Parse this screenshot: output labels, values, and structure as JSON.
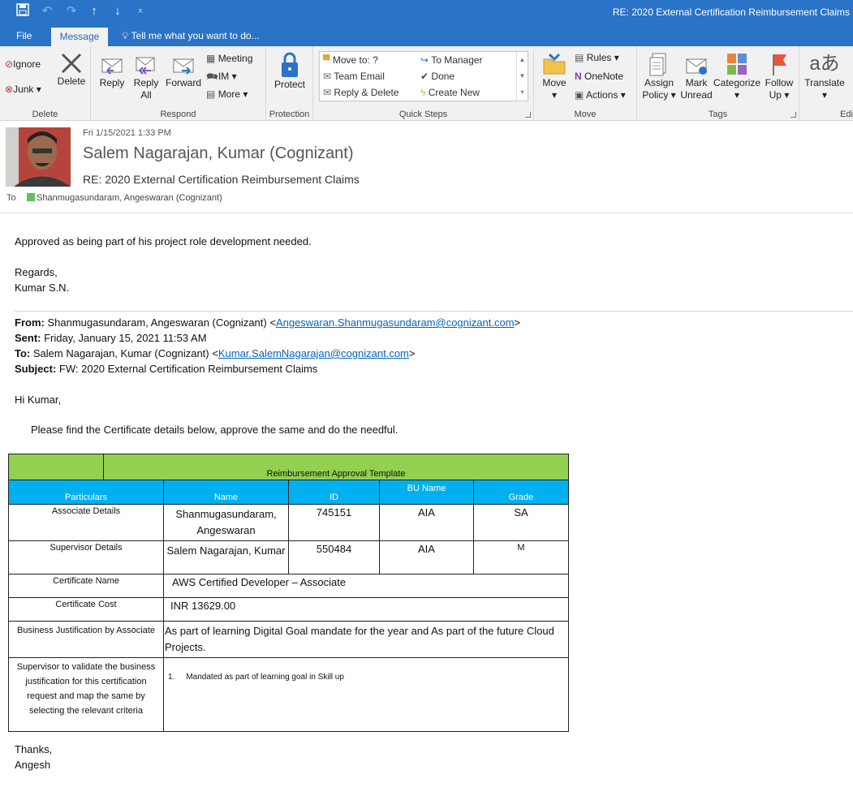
{
  "titlebar": {
    "title": "RE: 2020 External Certification Reimbursement Claims",
    "qa_icons": [
      "save-icon",
      "undo-icon",
      "redo-icon",
      "up-arrow-icon",
      "down-arrow-icon",
      "customize-icon"
    ]
  },
  "tabs": {
    "file": "File",
    "message": "Message",
    "tell": "Tell me what you want to do..."
  },
  "ribbon": {
    "delete": {
      "ignore": "Ignore",
      "junk": "Junk",
      "delete": "Delete",
      "label": "Delete"
    },
    "respond": {
      "reply": "Reply",
      "reply_all_1": "Reply",
      "reply_all_2": "All",
      "forward": "Forward",
      "meeting": "Meeting",
      "im": "IM",
      "more": "More",
      "label": "Respond"
    },
    "protection": {
      "protect": "Protect",
      "label": "Protection"
    },
    "quicksteps": {
      "items": [
        "Move to: ?",
        "Team Email",
        "Reply & Delete",
        "To Manager",
        "Done",
        "Create New"
      ],
      "label": "Quick Steps"
    },
    "move": {
      "move": "Move",
      "rules": "Rules",
      "onenote": "OneNote",
      "actions": "Actions",
      "label": "Move"
    },
    "tags": {
      "assign_1": "Assign",
      "assign_2": "Policy",
      "mark_1": "Mark",
      "mark_2": "Unread",
      "categorize": "Categorize",
      "follow_1": "Follow",
      "follow_2": "Up",
      "label": "Tags"
    },
    "editing": {
      "translate": "Translate",
      "label": "Edi"
    }
  },
  "header": {
    "date": "Fri 1/15/2021 1:33 PM",
    "sender": "Salem Nagarajan, Kumar (Cognizant)",
    "subject": "RE: 2020 External Certification Reimbursement Claims",
    "to_label": "To",
    "to_value": "Shanmugasundaram, Angeswaran (Cognizant)"
  },
  "body": {
    "line1": "Approved as being part of his project role development needed.",
    "regards": "Regards,",
    "sig": "Kumar S.N.",
    "from_label": "From:",
    "from_value": " Shanmugasundaram, Angeswaran (Cognizant) <",
    "from_email": "Angeswaran.Shanmugasundaram@cognizant.com",
    "from_end": ">",
    "sent_label": "Sent:",
    "sent_value": " Friday, January 15, 2021 11:53 AM",
    "to_label": "To:",
    "to_value": " Salem Nagarajan, Kumar (Cognizant) <",
    "to_email": "Kumar.SalemNagarajan@cognizant.com",
    "to_end": ">",
    "subject_label": "Subject:",
    "subject_value": " FW: 2020 External Certification Reimbursement Claims",
    "greeting": "Hi Kumar,",
    "intro": "Please find the Certificate details below, approve the same and do the needful.",
    "thanks": "Thanks,",
    "name": "Angesh"
  },
  "table": {
    "title": "Reimbursement Approval Template",
    "headers": [
      "Particulars",
      "Name",
      "ID",
      "BU Name",
      "Grade"
    ],
    "rows": [
      {
        "label": "Associate Details",
        "name": "Shanmugasundaram, Angeswaran",
        "id": "745151",
        "bu": "AIA",
        "grade": "SA"
      },
      {
        "label": "Supervisor Details",
        "name": "Salem Nagarajan, Kumar",
        "id": "550484",
        "bu": "AIA",
        "grade": "M"
      }
    ],
    "cert_name_label": "Certificate Name",
    "cert_name": "AWS Certified Developer – Associate",
    "cert_cost_label": "Certificate Cost",
    "cert_cost": "INR 13629.00",
    "justification_label": "Business Justification by Associate",
    "justification": "As part of learning Digital Goal mandate for the year and As part of the future Cloud Projects.",
    "validate_label": "Supervisor to validate the business justification for this certification request and map the same by selecting the relevant criteria",
    "validate_num": "1.",
    "validate_value": "Mandated as part of learning goal in Skill up"
  }
}
